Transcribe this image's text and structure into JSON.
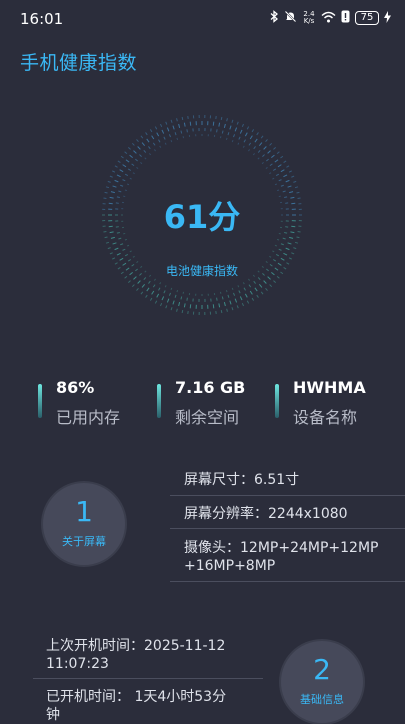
{
  "status_bar": {
    "time": "16:01",
    "net_speed_value": "2.4",
    "net_speed_unit": "K/s",
    "battery_level": "75",
    "icons": [
      "bluetooth-icon",
      "mute-icon",
      "wifi-icon",
      "alert-icon",
      "battery-icon",
      "charging-icon"
    ]
  },
  "header": {
    "title": "手机健康指数"
  },
  "dial": {
    "score": "61分",
    "label": "电池健康指数"
  },
  "stats": [
    {
      "value": "86%",
      "label": "已用内存"
    },
    {
      "value": "7.16 GB",
      "label": "剩余空间"
    },
    {
      "value": "HWHMA",
      "label": "设备名称"
    }
  ],
  "screen_section": {
    "number": "1",
    "title": "关于屏幕",
    "lines": [
      "屏幕尺寸：6.51寸",
      "屏幕分辨率：2244x1080",
      "摄像头：12MP+24MP+12MP",
      "+16MP+8MP"
    ]
  },
  "basic_section": {
    "number": "2",
    "title": "基础信息",
    "lines": [
      "上次开机时间：2025-11-12",
      "11:07:23",
      "已开机时间： 1天4小时53分",
      "钟"
    ]
  },
  "colors": {
    "background": "#2b2d3b",
    "accent": "#3ab8f5",
    "circle_bg": "#46495a",
    "bar_gradient_top": "#6ee7e0"
  }
}
